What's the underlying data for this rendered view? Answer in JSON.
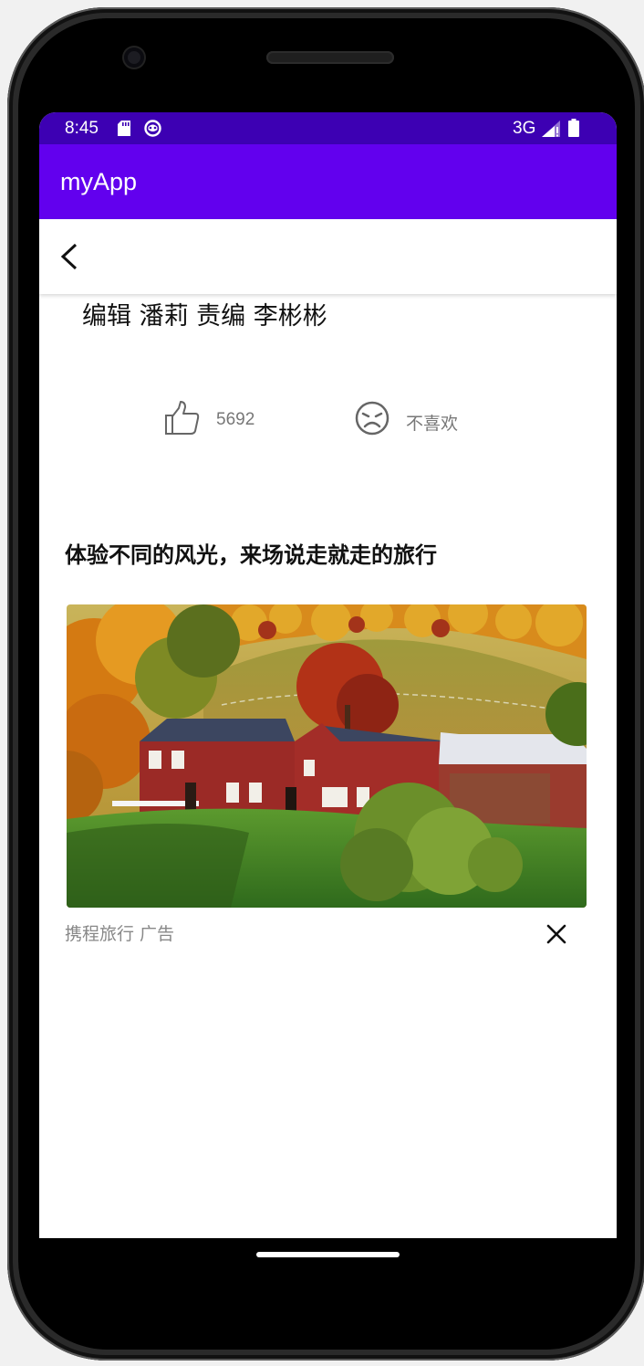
{
  "status_bar": {
    "time": "8:45",
    "network_type": "3G",
    "icons": [
      "sd-card-icon",
      "vpn-icon",
      "signal-icon",
      "battery-icon"
    ]
  },
  "app_bar": {
    "title": "myApp",
    "color": "#6200ee",
    "status_color": "#3d00b3"
  },
  "toolbar": {
    "back_icon": "chevron-left-icon"
  },
  "article": {
    "editor_line": "编辑 潘莉 责编 李彬彬",
    "like_count": "5692",
    "dislike_label": "不喜欢"
  },
  "ad": {
    "headline": "体验不同的风光，来场说走就走的旅行",
    "image_icon": "landscape-photo",
    "source_label": "携程旅行 广告",
    "close_icon": "close-icon"
  }
}
